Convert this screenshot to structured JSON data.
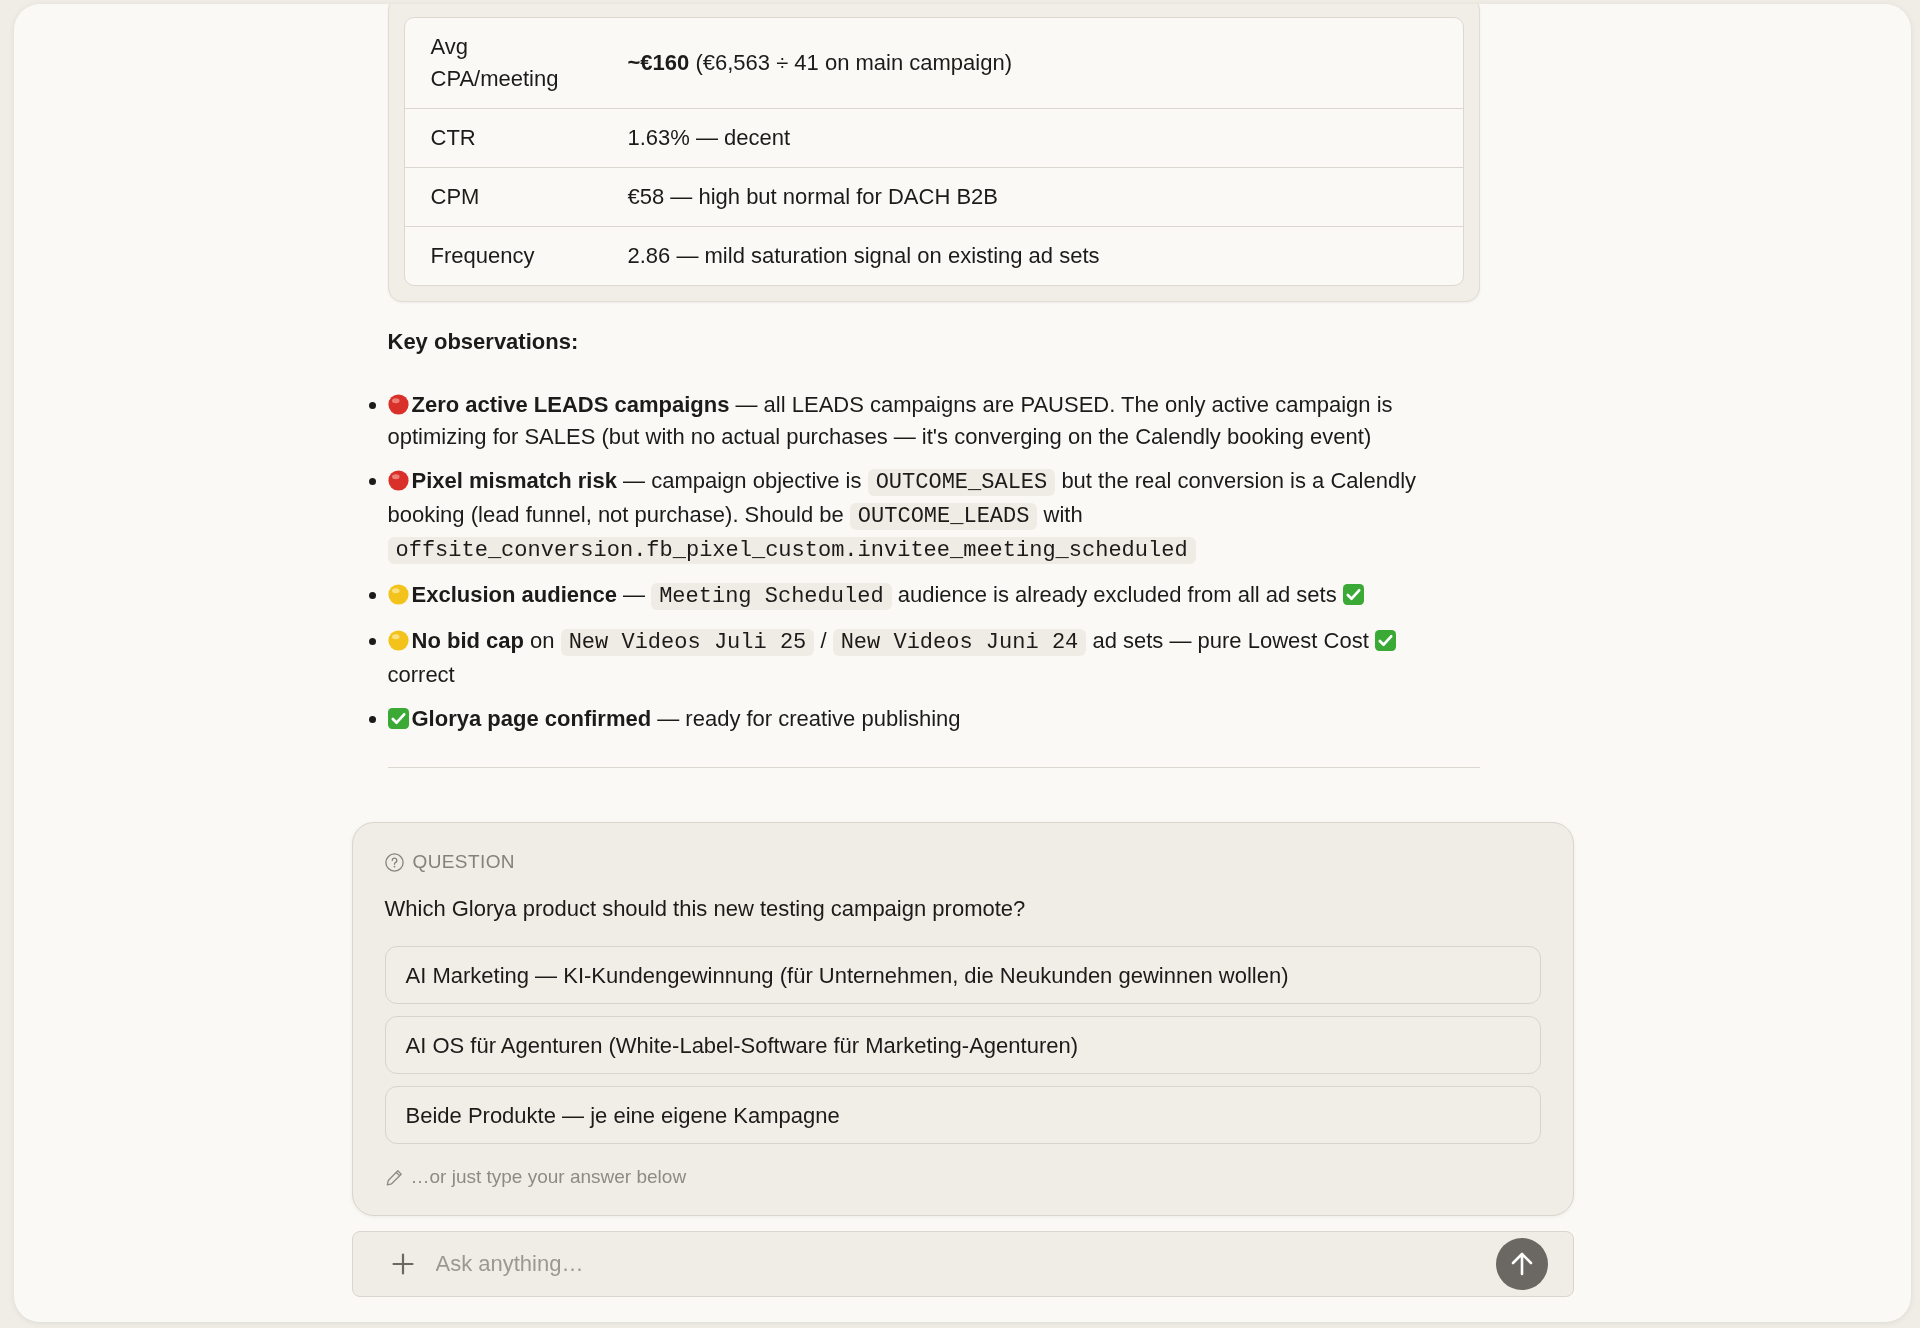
{
  "metrics_table": {
    "rows": [
      {
        "metric": "Avg CPA/meeting",
        "value": "**~€160** (€6,563 ÷ 41 on main campaign)"
      },
      {
        "metric": "CTR",
        "value": "1.63% — decent"
      },
      {
        "metric": "CPM",
        "value": "€58 — high but normal for DACH B2B"
      },
      {
        "metric": "Frequency",
        "value": "2.86 — mild saturation signal on existing ad sets"
      }
    ]
  },
  "observations": {
    "heading": "Key observations:",
    "items": [
      {
        "kind": "critical",
        "segments": [
          {
            "kind": "text",
            "text": "**Zero active LEADS campaigns** — all LEADS campaigns are PAUSED. The only active campaign is optimizing for SALES (but with no actual purchases — it's converging on the Calendly booking event)"
          }
        ]
      },
      {
        "kind": "critical",
        "segments": [
          {
            "kind": "text",
            "text": "**Pixel mismatch risk** — campaign objective is "
          },
          {
            "kind": "code",
            "text": "OUTCOME_SALES"
          },
          {
            "kind": "text",
            "text": " but the real conversion is a Calendly booking (lead funnel, not purchase). Should be "
          },
          {
            "kind": "code",
            "text": "OUTCOME_LEADS"
          },
          {
            "kind": "text",
            "text": " with "
          },
          {
            "kind": "code",
            "text": "offsite_conversion.fb_pixel_custom.invitee_meeting_scheduled"
          }
        ]
      },
      {
        "kind": "warning",
        "segments": [
          {
            "kind": "text",
            "text": "**Exclusion audience** — "
          },
          {
            "kind": "code",
            "text": "Meeting Scheduled"
          },
          {
            "kind": "text",
            "text": " audience is already excluded from all ad sets "
          },
          {
            "kind": "check"
          }
        ]
      },
      {
        "kind": "warning",
        "segments": [
          {
            "kind": "text",
            "text": "**No bid cap** on "
          },
          {
            "kind": "code",
            "text": "New Videos Juli 25"
          },
          {
            "kind": "text",
            "text": " / "
          },
          {
            "kind": "code",
            "text": "New Videos Juni 24"
          },
          {
            "kind": "text",
            "text": " ad sets — pure Lowest Cost "
          },
          {
            "kind": "check"
          },
          {
            "kind": "text",
            "text": " correct"
          }
        ]
      },
      {
        "kind": "ok",
        "segments": [
          {
            "kind": "text",
            "text": "**Glorya page confirmed** — ready for creative publishing"
          }
        ]
      }
    ]
  },
  "question": {
    "label": "QUESTION",
    "text": "Which Glorya product should this new testing campaign promote?",
    "options": [
      {
        "label": "AI Marketing — KI-Kundengewinnung (für Unternehmen, die Neukunden gewinnen wollen)",
        "selected": false
      },
      {
        "label": "AI OS für Agenturen (White-Label-Software für Marketing-Agenturen)",
        "selected": false
      },
      {
        "label": "Beide Produkte — je eine eigene Kampagne",
        "selected": false
      }
    ],
    "hint": "…or just type your answer below"
  },
  "composer": {
    "placeholder": "Ask anything…"
  }
}
